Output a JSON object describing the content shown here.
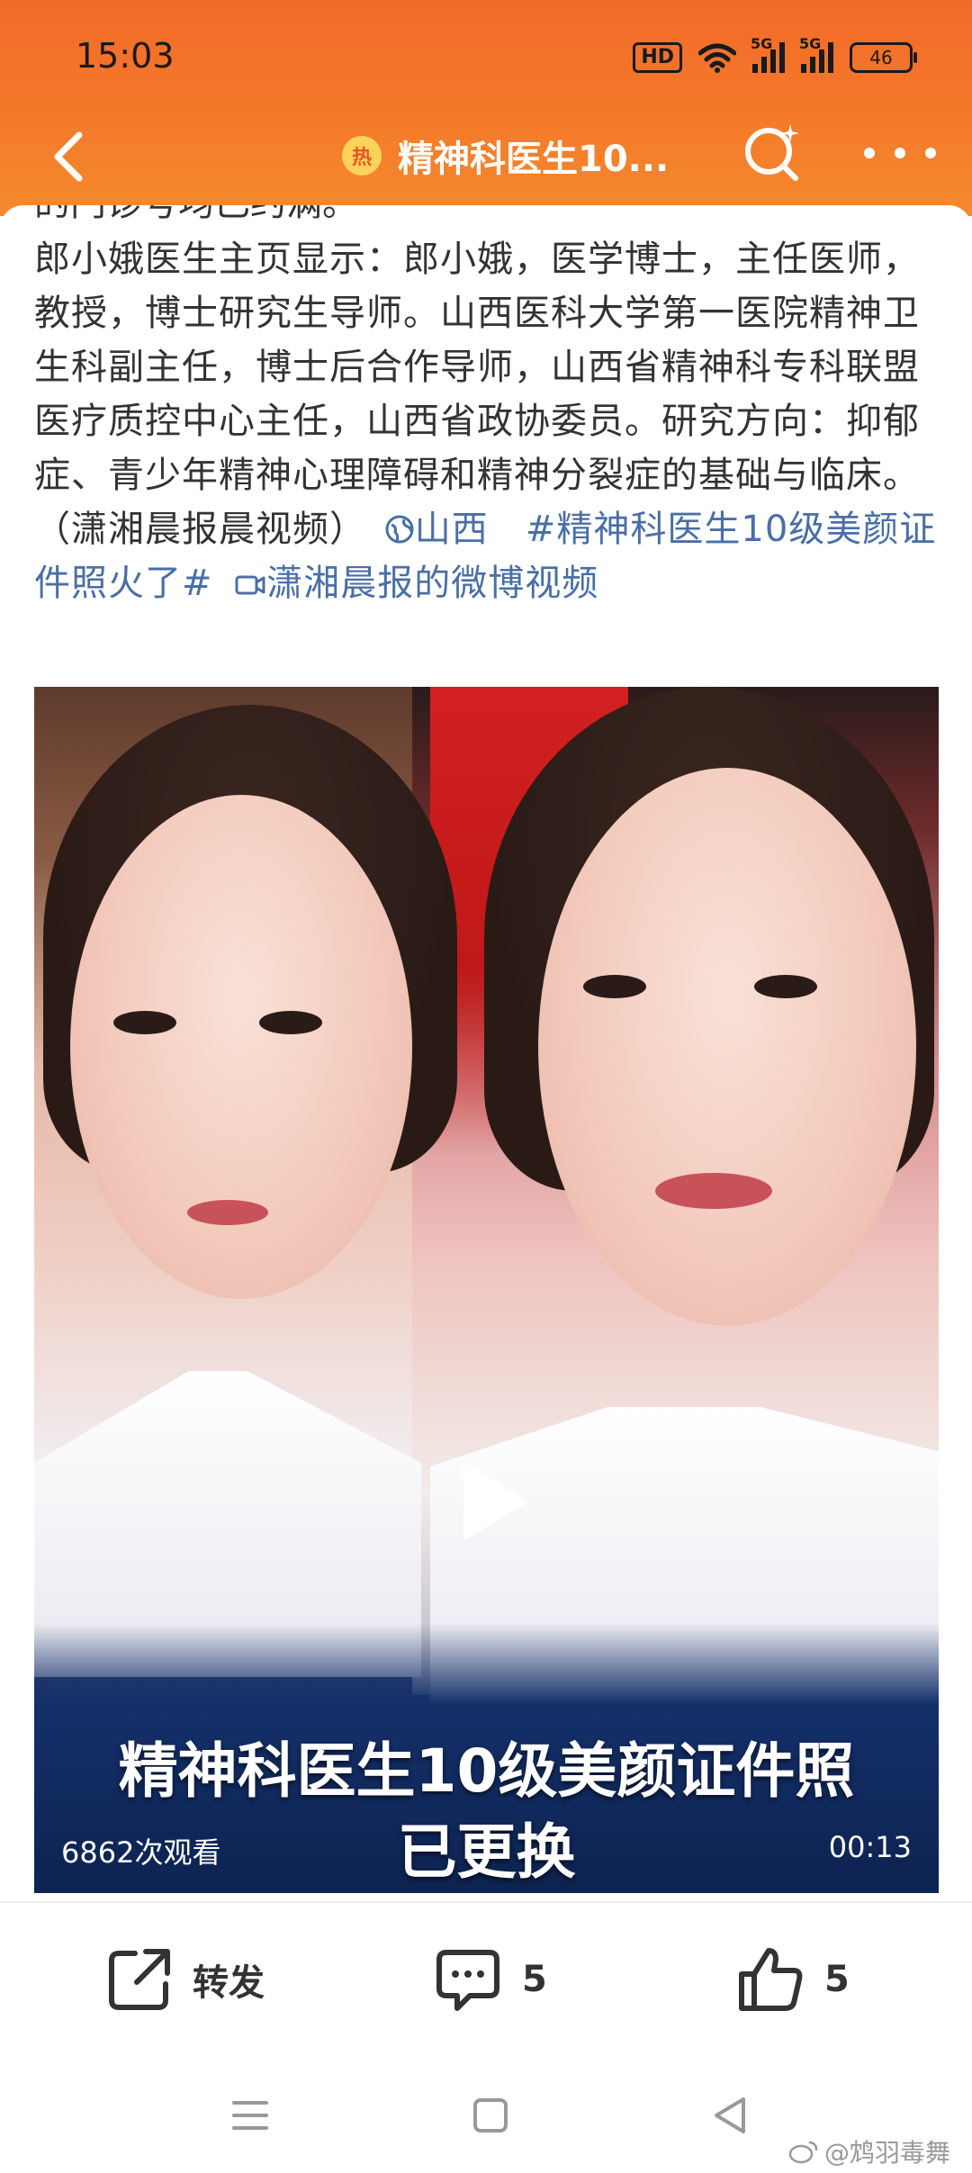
{
  "status": {
    "time": "15:03",
    "hd": "HD",
    "sig1": "5G",
    "sig2": "5G",
    "battery": "46"
  },
  "nav": {
    "hot_badge": "热",
    "title": "精神科医生10..."
  },
  "article": {
    "clipped_line": "的门诊号均已约满。",
    "paragraph": "郎小娥医生主页显示：郎小娥，医学博士，主任医师，教授，博士研究生导师。山西医科大学第一医院精神卫生科副主任，博士后合作导师，山西省精神科专科联盟医疗质控中心主任，山西省政协委员。研究方向：抑郁症、青少年精神心理障碍和精神分裂症的基础与临床。（潇湘晨报晨视频）",
    "location": "山西",
    "hashtag": "#精神科医生10级美颜证件照火了#",
    "video_link": "潇湘晨报的微博视频"
  },
  "video": {
    "caption_line1": "精神科医生10级美颜证件照",
    "caption_line2": "已更换",
    "views": "6862次观看",
    "duration": "00:13"
  },
  "actions": {
    "repost_label": "转发",
    "comment_count": "5",
    "like_count": "5"
  },
  "watermark": "@鸩羽毒舞",
  "colors": {
    "header": "#f47a2a",
    "link": "#4a6fa5"
  }
}
